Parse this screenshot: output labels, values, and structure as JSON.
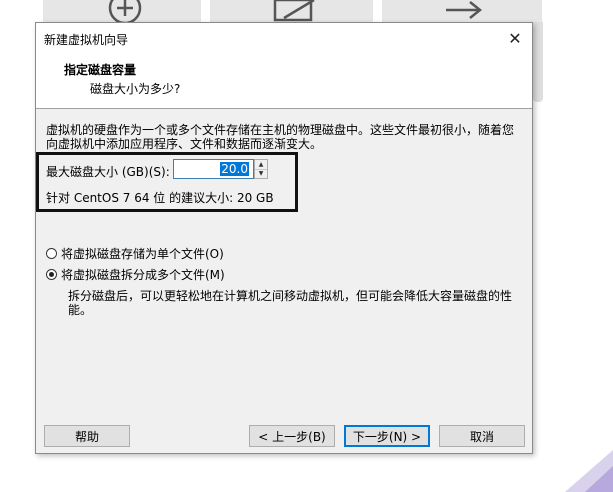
{
  "dialog": {
    "title": "新建虚拟机向导",
    "close_glyph": "✕",
    "header_title": "指定磁盘容量",
    "header_subtitle": "磁盘大小为多少?",
    "description": "虚拟机的硬盘作为一个或多个文件存储在主机的物理磁盘中。这些文件最初很小，随着您向虚拟机中添加应用程序、文件和数据而逐渐变大。",
    "max_size_label": "最大磁盘大小 (GB)(S):",
    "max_size_value": "20.0",
    "recommend_text": "针对 CentOS 7 64 位 的建议大小: 20 GB",
    "options": [
      {
        "label": "将虚拟磁盘存储为单个文件(O)",
        "checked": false
      },
      {
        "label": "将虚拟磁盘拆分成多个文件(M)",
        "checked": true
      }
    ],
    "split_note": "拆分磁盘后，可以更轻松地在计算机之间移动虚拟机，但可能会降低大容量磁盘的性能。",
    "buttons": {
      "help": "帮助",
      "back": "< 上一步(B)",
      "next": "下一步(N) >",
      "cancel": "取消"
    }
  },
  "background": {
    "toolbar_icons": [
      "plus-circle-icon",
      "edit-icon",
      "arrow-right-icon"
    ]
  },
  "colors": {
    "dialog_bg": "#f0f0f0",
    "accent": "#0078d7",
    "highlight_border": "#111111"
  }
}
